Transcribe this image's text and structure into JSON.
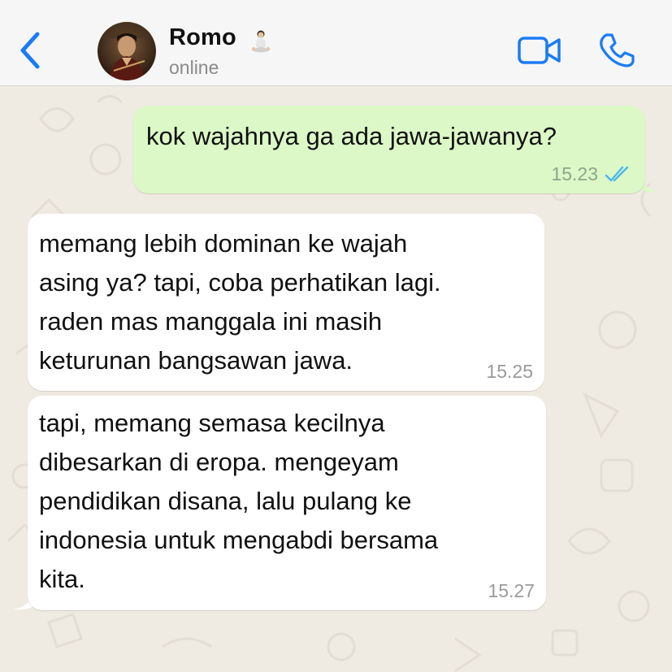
{
  "header": {
    "contact_name": "Romo",
    "status": "online",
    "back_icon": "chevron-left-icon",
    "video_icon": "video-camera-icon",
    "call_icon": "phone-icon",
    "name_emoji": "person-in-lotus-position",
    "accent_color": "#1a7cf5"
  },
  "messages": [
    {
      "direction": "outgoing",
      "text": "kok wajahnya ga ada jawa-jawanya?",
      "time": "15.23",
      "status": "read",
      "bubble_color": "#dcf8c6"
    },
    {
      "direction": "incoming",
      "text": "memang lebih dominan ke wajah\nasing ya? tapi, coba perhatikan lagi.\nraden mas manggala ini masih\nketurunan bangsawan jawa.",
      "time": "15.25",
      "bubble_color": "#ffffff"
    },
    {
      "direction": "incoming",
      "text": "tapi, memang semasa kecilnya\ndibesarkan di eropa. mengeyam\npendidikan disana, lalu pulang ke\nindonesia untuk mengabdi bersama\nkita.",
      "time": "15.27",
      "bubble_color": "#ffffff"
    }
  ],
  "colors": {
    "chat_background": "#efeae2",
    "header_background": "#f6f6f6",
    "read_ticks": "#4fb6ec"
  }
}
